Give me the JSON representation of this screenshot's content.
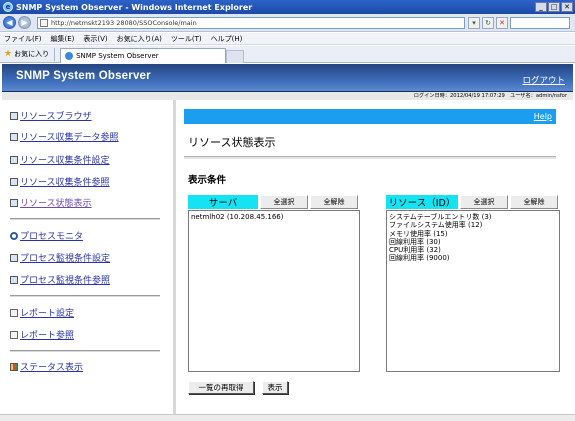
{
  "window": {
    "title": "SNMP System Observer - Windows Internet Explorer",
    "url": "http://netmskt2193  28080/SSOConsole/main",
    "menu": [
      "ファイル(F)",
      "編集(E)",
      "表示(V)",
      "お気に入り(A)",
      "ツール(T)",
      "ヘルプ(H)"
    ],
    "favorites_label": "お気に入り",
    "tab_title": "SNMP System Observer"
  },
  "header": {
    "app_title": "SNMP System Observer",
    "logout": "ログアウト",
    "login_info": "ログイン日時：2012/04/19 17:07:29　ユーザ名：admin/nsfor"
  },
  "sidebar": {
    "items": [
      {
        "label": "リソースブラウザ",
        "icon": "resource-browser-icon"
      },
      {
        "label": "リソース収集データ参照",
        "icon": "collection-data-icon"
      },
      {
        "label": "リソース収集条件設定",
        "icon": "collection-setting-icon"
      },
      {
        "label": "リソース収集条件参照",
        "icon": "collection-reference-icon"
      },
      {
        "label": "リソース状態表示",
        "icon": "resource-status-icon"
      },
      {
        "label": "プロセスモニタ",
        "icon": "magnifier-icon"
      },
      {
        "label": "プロセス監視条件設定",
        "icon": "process-setting-icon"
      },
      {
        "label": "プロセス監視条件参照",
        "icon": "process-reference-icon"
      },
      {
        "label": "レポート設定",
        "icon": "report-setting-icon"
      },
      {
        "label": "レポート参照",
        "icon": "report-reference-icon"
      },
      {
        "label": "ステータス表示",
        "icon": "status-icon"
      }
    ]
  },
  "main": {
    "help": "Help",
    "title": "リソース状態表示",
    "section": "表示条件",
    "server_panel": {
      "title": "サーバ",
      "select_all": "全選択",
      "deselect_all": "全解除",
      "items": [
        "netmlh02 (10.208.45.166)"
      ]
    },
    "resource_panel": {
      "title": "リソース（ID）",
      "select_all": "全選択",
      "deselect_all": "全解除",
      "items": [
        "システムテーブルエントリ数 (3)",
        "ファイルシステム使用率 (12)",
        "メモリ使用率 (15)",
        "回線利用率 (30)",
        "CPU利用率 (32)",
        "回線利用率 (9000)"
      ]
    },
    "reload_button": "一覧の再取得",
    "show_button": "表示"
  }
}
